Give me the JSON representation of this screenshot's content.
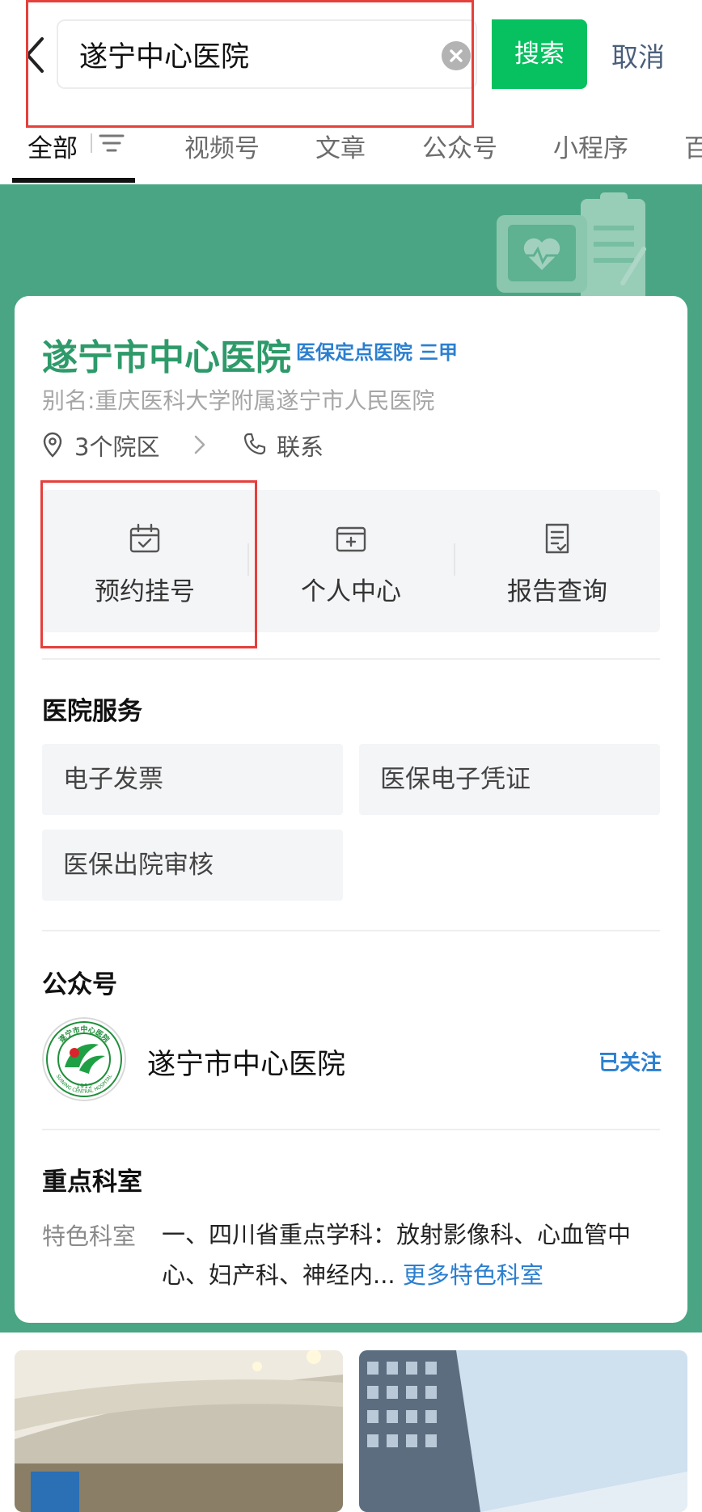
{
  "search": {
    "query": "遂宁中心医院",
    "button_label": "搜索",
    "cancel_label": "取消"
  },
  "tabs": [
    {
      "label": "全部"
    },
    {
      "label": "视频号"
    },
    {
      "label": "文章"
    },
    {
      "label": "公众号"
    },
    {
      "label": "小程序"
    },
    {
      "label": "百"
    }
  ],
  "hospital": {
    "name": "遂宁市中心医院",
    "tags": [
      "医保定点医院",
      "三甲"
    ],
    "alias": "别名:重庆医科大学附属遂宁市人民医院",
    "campuses": "3个院区",
    "contact": "联系"
  },
  "quick_actions": [
    {
      "label": "预约挂号",
      "icon": "calendar-check-icon"
    },
    {
      "label": "个人中心",
      "icon": "wallet-card-icon"
    },
    {
      "label": "报告查询",
      "icon": "document-report-icon"
    }
  ],
  "services": {
    "title": "医院服务",
    "items": [
      "电子发票",
      "医保电子凭证",
      "医保出院审核"
    ]
  },
  "official_account": {
    "title": "公众号",
    "name": "遂宁市中心医院",
    "status": "已关注",
    "logo_text": "遂宁市中心医院",
    "logo_year": "1912",
    "logo_en": "SUINING CENTRAL HOSPITAL"
  },
  "departments": {
    "title": "重点科室",
    "label": "特色科室",
    "text": "一、四川省重点学科：放射影像科、心血管中心、妇产科、神经内...",
    "more": "更多特色科室"
  },
  "colors": {
    "brand_green": "#07c160",
    "header_green": "#4aa584",
    "name_green": "#2e9a6a",
    "link_blue": "#2b7fd0",
    "highlight_red": "#e5403c"
  }
}
